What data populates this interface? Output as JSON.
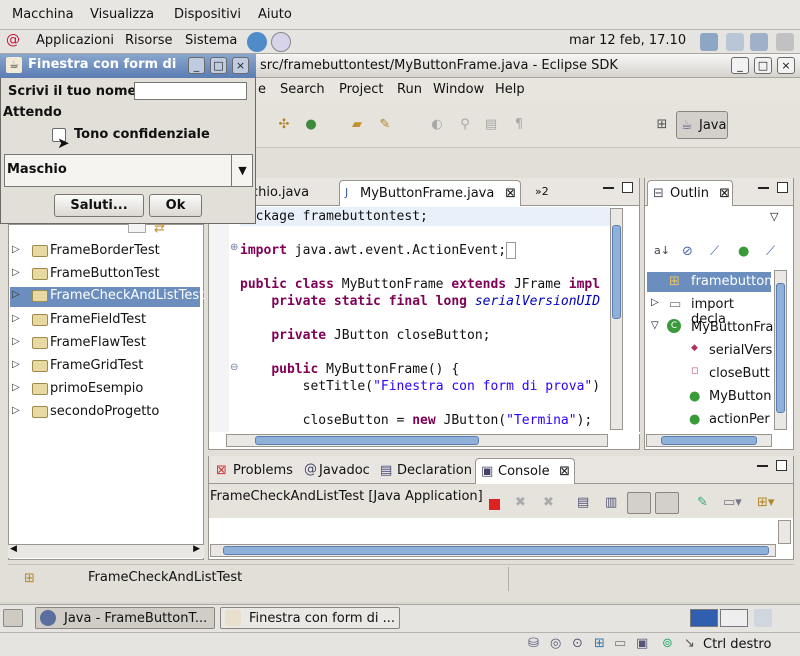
{
  "vbox_menu": {
    "items": [
      "Macchina",
      "Visualizza",
      "Dispositivi",
      "Aiuto"
    ]
  },
  "gnome_panel": {
    "items": [
      "Applicazioni",
      "Risorse",
      "Sistema"
    ],
    "clock": "mar 12 feb, 17.10"
  },
  "eclipse": {
    "title": "src/framebuttontest/MyButtonFrame.java - Eclipse SDK",
    "menu": [
      "e",
      "Search",
      "Project",
      "Run",
      "Window",
      "Help"
    ],
    "perspective": "Java",
    "editor_tabs": [
      "chio.java",
      "MyButtonFrame.java",
      "»2"
    ],
    "outline_tab": "Outlin",
    "code_lines": [
      {
        "pre": "",
        "kw": "",
        "rest": "ckage framebuttontest;"
      },
      {
        "pre": "",
        "kw": "import",
        "rest": " java.awt.event.ActionEvent;"
      },
      {
        "pre": "",
        "kw": "public class",
        "rest": " MyButtonFrame "
      },
      {
        "pre": "",
        "kw": "extends",
        "rest": " JFrame "
      },
      {
        "pre": "",
        "kw": "impl",
        "rest": ""
      },
      {
        "pre": "    ",
        "kw": "private static final long",
        "rest": " "
      },
      {
        "pre": "",
        "kw": "",
        "rest": "serialVersionUID"
      },
      {
        "pre": "    ",
        "kw": "private",
        "rest": " JButton closeButton;"
      },
      {
        "pre": "    ",
        "kw": "public",
        "rest": " MyButtonFrame() {"
      },
      {
        "pre": "        ",
        "kw": "",
        "rest": "setTitle("
      },
      {
        "pre": "",
        "kw": "",
        "rest": "\"Finestra con form di prova\""
      },
      {
        "pre": "",
        "kw": "",
        "rest": ")"
      },
      {
        "pre": "        ",
        "kw": "",
        "rest": "closeButton = "
      },
      {
        "pre": "",
        "kw": "new",
        "rest": " JButton("
      },
      {
        "pre": "",
        "kw": "",
        "rest": "\"Termina\""
      },
      {
        "pre": "",
        "kw": "",
        "rest": ");"
      }
    ],
    "package_tree": [
      {
        "label": "FrameBorderTest",
        "selected": false
      },
      {
        "label": "FrameButtonTest",
        "selected": false
      },
      {
        "label": "FrameCheckAndListTest",
        "selected": true
      },
      {
        "label": "FrameFieldTest",
        "selected": false
      },
      {
        "label": "FrameFlawTest",
        "selected": false
      },
      {
        "label": "FrameGridTest",
        "selected": false
      },
      {
        "label": "primoEsempio",
        "selected": false
      },
      {
        "label": "secondoProgetto",
        "selected": false
      }
    ],
    "outline_items": [
      "framebutton",
      "import decla",
      "MyButtonFra",
      "serialVers",
      "closeButt",
      "MyButton",
      "actionPer"
    ],
    "bottom_tabs": [
      "Problems",
      "Javadoc",
      "Declaration",
      "Console"
    ],
    "console_label": "FrameCheckAndListTest [Java Application]",
    "status": "FrameCheckAndListTest"
  },
  "dialog": {
    "title": "Finestra con form di",
    "name_label": "Scrivi il tuo nome",
    "name_value": "",
    "waiting_label": "Attendo",
    "checkbox_label": "Tono confidenziale",
    "checkbox_checked": false,
    "combo_value": "Maschio",
    "btn_hello": "Saluti...",
    "btn_ok": "Ok"
  },
  "taskbar": {
    "items": [
      "Java - FrameButtonT...",
      "Finestra con form di ..."
    ]
  },
  "vbox_status": {
    "host_key": "Ctrl destro"
  }
}
